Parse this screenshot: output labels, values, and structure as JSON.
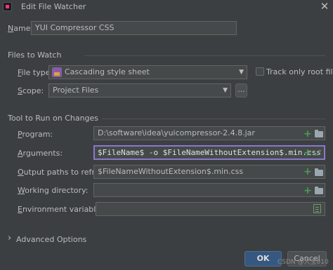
{
  "window": {
    "title": "Edit File Watcher",
    "close_glyph": "✕"
  },
  "name": {
    "label_prefix": "",
    "label_mnemonic": "N",
    "label_rest": "ame:",
    "value": "YUI Compressor CSS"
  },
  "files_to_watch": {
    "section_title": "Files to Watch",
    "file_type_label_mnemonic": "F",
    "file_type_label_rest": "ile type:",
    "file_type_value": "Cascading style sheet",
    "track_only_root_label": "Track only root files",
    "track_only_root_checked": false,
    "scope_label_mnemonic": "S",
    "scope_label_rest": "cope:",
    "scope_value": "Project Files",
    "scope_more_glyph": "..."
  },
  "tool_to_run": {
    "section_title": "Tool to Run on Changes",
    "program_label_mnemonic": "P",
    "program_label_rest": "rogram:",
    "program_value": "D:\\software\\idea\\yuicompressor-2.4.8.jar",
    "arguments_label_mnemonic": "A",
    "arguments_label_rest": "rguments:",
    "arguments_value": "$FileName$ -o $FileNameWithoutExtension$.min.css",
    "output_paths_label_mnemonic": "O",
    "output_paths_label_rest": "utput paths to refresh:",
    "output_paths_value": "$FileNameWithoutExtension$.min.css",
    "working_dir_label_mnemonic": "W",
    "working_dir_label_rest": "orking directory:",
    "working_dir_value": "",
    "env_vars_label_mnemonic": "E",
    "env_vars_label_rest": "nvironment variables:",
    "env_vars_value": "",
    "plus_glyph": "+",
    "expand_glyph": "⤢"
  },
  "advanced": {
    "chevron_glyph": "›",
    "label": "Advanced Options"
  },
  "footer": {
    "ok_label": "OK",
    "cancel_label": "Cancel",
    "watermark": "CSDN @大宝810"
  },
  "colors": {
    "background": "#3c3f41",
    "field_bg": "#45494a",
    "focus_border": "#8a78c9",
    "plus_green": "#499c54",
    "ok_button": "#365880"
  },
  "icons": {
    "app": "intellij-app-icon",
    "file_type": "css-file-icon",
    "folder": "folder-icon",
    "plus": "plus-icon",
    "expand": "expand-icon",
    "notes": "notes-icon"
  }
}
